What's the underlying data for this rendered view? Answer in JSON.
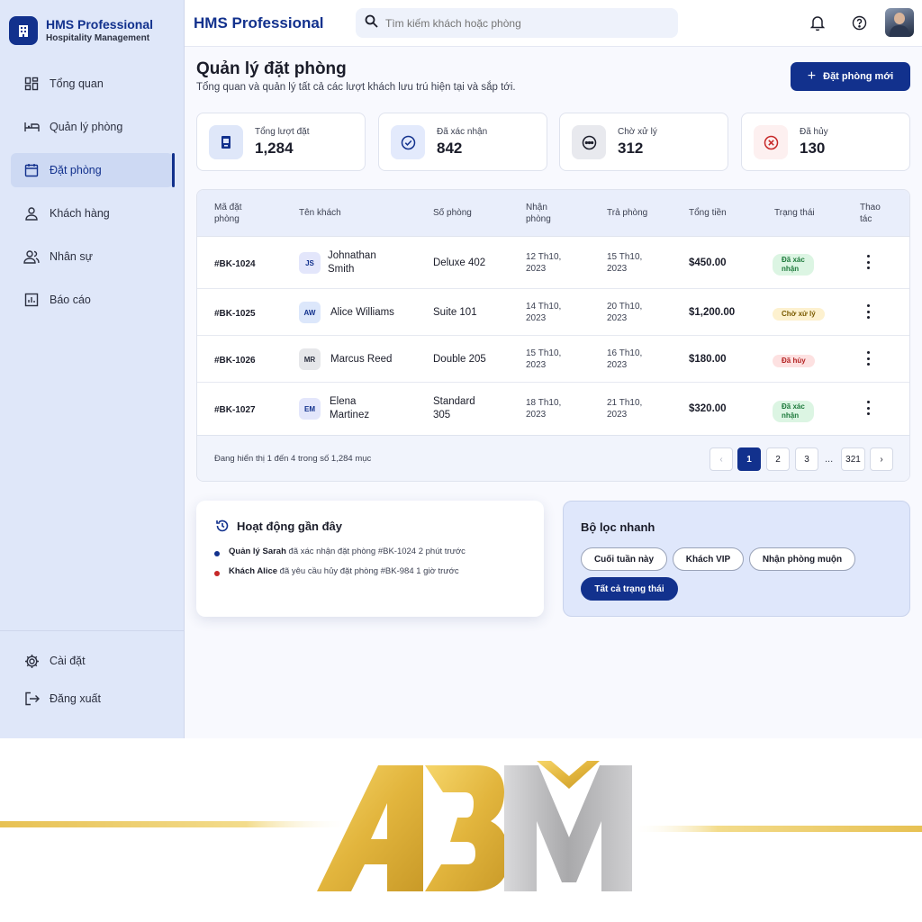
{
  "colors": {
    "primary": "#12318d",
    "sidebar_bg": "#dfe7f9",
    "gold": "#e2b53d",
    "silver": "#a9a9ab"
  },
  "brand": {
    "name": "HMS Professional",
    "subtitle": "Hospitality Management",
    "icon": "building-icon"
  },
  "sidebar": {
    "items": [
      {
        "label": "Tổng quan",
        "icon": "dashboard-icon",
        "active": false
      },
      {
        "label": "Quản lý phòng",
        "icon": "bed-icon",
        "active": false
      },
      {
        "label": "Đặt phòng",
        "icon": "calendar-icon",
        "active": true
      },
      {
        "label": "Khách hàng",
        "icon": "person-icon",
        "active": false
      },
      {
        "label": "Nhân sự",
        "icon": "group-icon",
        "active": false
      },
      {
        "label": "Báo cáo",
        "icon": "chart-icon",
        "active": false
      }
    ],
    "bottom": [
      {
        "label": "Cài đặt",
        "icon": "gear-icon"
      },
      {
        "label": "Đăng xuất",
        "icon": "logout-icon"
      }
    ]
  },
  "topbar": {
    "title": "HMS Professional",
    "search_placeholder": "Tìm kiếm khách hoặc phòng"
  },
  "header": {
    "title": "Quản lý đặt phòng",
    "subtitle": "Tổng quan và quản lý tất cả các lượt khách lưu trú hiện tại và sắp tới.",
    "new_button": "Đặt phòng mới"
  },
  "stats": [
    {
      "label": "Tổng lượt đặt",
      "value": "1,284",
      "icon": "door-icon"
    },
    {
      "label": "Đã xác nhận",
      "value": "842",
      "icon": "check-circle-icon"
    },
    {
      "label": "Chờ xử lý",
      "value": "312",
      "icon": "pending-icon"
    },
    {
      "label": "Đã hủy",
      "value": "130",
      "icon": "cancel-icon"
    }
  ],
  "table": {
    "headers": {
      "id": [
        "Mã đặt",
        "phòng"
      ],
      "guest": "Tên khách",
      "room": "Số phòng",
      "checkin": [
        "Nhận",
        "phòng"
      ],
      "checkout": "Trả phòng",
      "total": "Tổng tiền",
      "status": "Trạng thái",
      "action": [
        "Thao",
        "tác"
      ]
    },
    "rows": [
      {
        "id": "#BK-1024",
        "initials": "JS",
        "guest": [
          "Johnathan",
          "Smith"
        ],
        "room": [
          "Deluxe 402"
        ],
        "checkin": [
          "12 Th10,",
          "2023"
        ],
        "checkout": [
          "15 Th10,",
          "2023"
        ],
        "total": "$450.00",
        "status": [
          "Đã xác",
          "nhận"
        ],
        "status_type": "confirmed"
      },
      {
        "id": "#BK-1025",
        "initials": "AW",
        "guest": [
          "Alice Williams"
        ],
        "room": [
          "Suite 101"
        ],
        "checkin": [
          "14 Th10,",
          "2023"
        ],
        "checkout": [
          "20 Th10,",
          "2023"
        ],
        "total": "$1,200.00",
        "status": [
          "Chờ xử lý"
        ],
        "status_type": "pending"
      },
      {
        "id": "#BK-1026",
        "initials": "MR",
        "guest": [
          "Marcus Reed"
        ],
        "room": [
          "Double 205"
        ],
        "checkin": [
          "15 Th10,",
          "2023"
        ],
        "checkout": [
          "16 Th10,",
          "2023"
        ],
        "total": "$180.00",
        "status": [
          "Đã hủy"
        ],
        "status_type": "cancelled"
      },
      {
        "id": "#BK-1027",
        "initials": "EM",
        "guest": [
          "Elena",
          "Martinez"
        ],
        "room": [
          "Standard",
          "305"
        ],
        "checkin": [
          "18 Th10,",
          "2023"
        ],
        "checkout": [
          "21 Th10,",
          "2023"
        ],
        "total": "$320.00",
        "status": [
          "Đã xác",
          "nhận"
        ],
        "status_type": "confirmed"
      }
    ],
    "footer": "Đang hiển thị 1 đến 4 trong số 1,284 mục",
    "pagination": {
      "prev": "‹",
      "pages": [
        "1",
        "2",
        "3"
      ],
      "ellipsis": "...",
      "last": "321",
      "next": "›",
      "current": "1"
    }
  },
  "activity": {
    "title": "Hoạt động gần đây",
    "items": [
      {
        "actor": "Quản lý Sarah",
        "text": "đã xác nhận đặt phòng #BK-1024 2 phút trước",
        "dot_color": "#12318d"
      },
      {
        "actor": "Khách Alice",
        "text": "đã yêu cầu hủy đặt phòng #BK-984 1 giờ trước",
        "dot_color": "#c62828"
      }
    ]
  },
  "filters": {
    "title": "Bộ lọc nhanh",
    "chips": [
      "Cuối tuần này",
      "Khách VIP",
      "Nhận phòng muộn"
    ],
    "active_chip": "Tất cả trạng thái"
  },
  "logo": {
    "text": "ABM"
  }
}
